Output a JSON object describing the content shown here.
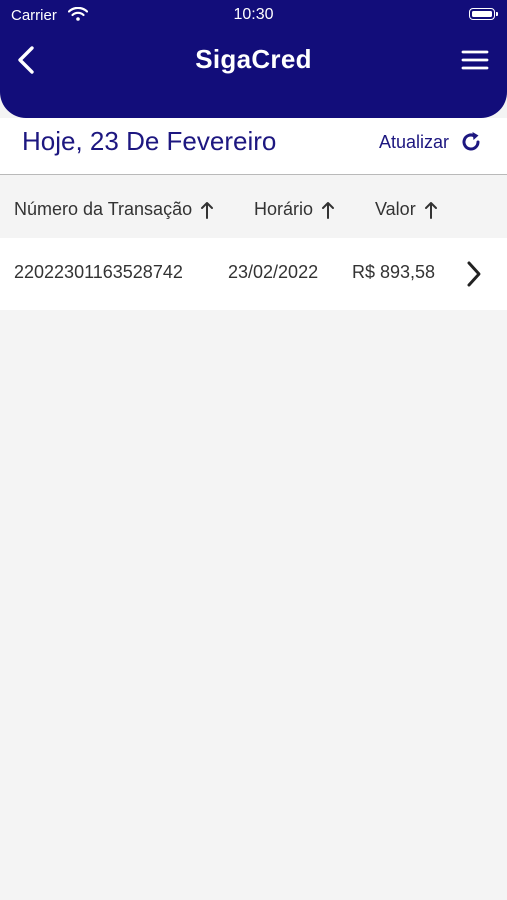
{
  "status_bar": {
    "carrier": "Carrier",
    "time": "10:30"
  },
  "header": {
    "title": "SigaCred",
    "back_icon": "chevron-left-icon",
    "menu_icon": "hamburger-menu-icon"
  },
  "date_section": {
    "title": "Hoje, 23 De Fevereiro",
    "refresh_label": "Atualizar",
    "refresh_icon": "refresh-icon"
  },
  "table": {
    "columns": [
      {
        "label": "Número da Transação",
        "sort_icon": "arrow-up-icon"
      },
      {
        "label": "Horário",
        "sort_icon": "arrow-up-icon"
      },
      {
        "label": "Valor",
        "sort_icon": "arrow-up-icon"
      }
    ],
    "rows": [
      {
        "transaction_number": "22022301163528742",
        "time": "23/02/2022",
        "value": "R$ 893,58"
      }
    ]
  },
  "colors": {
    "header_bg": "#120d7a",
    "accent_text": "#1d1780",
    "page_bg": "#f4f4f4"
  }
}
